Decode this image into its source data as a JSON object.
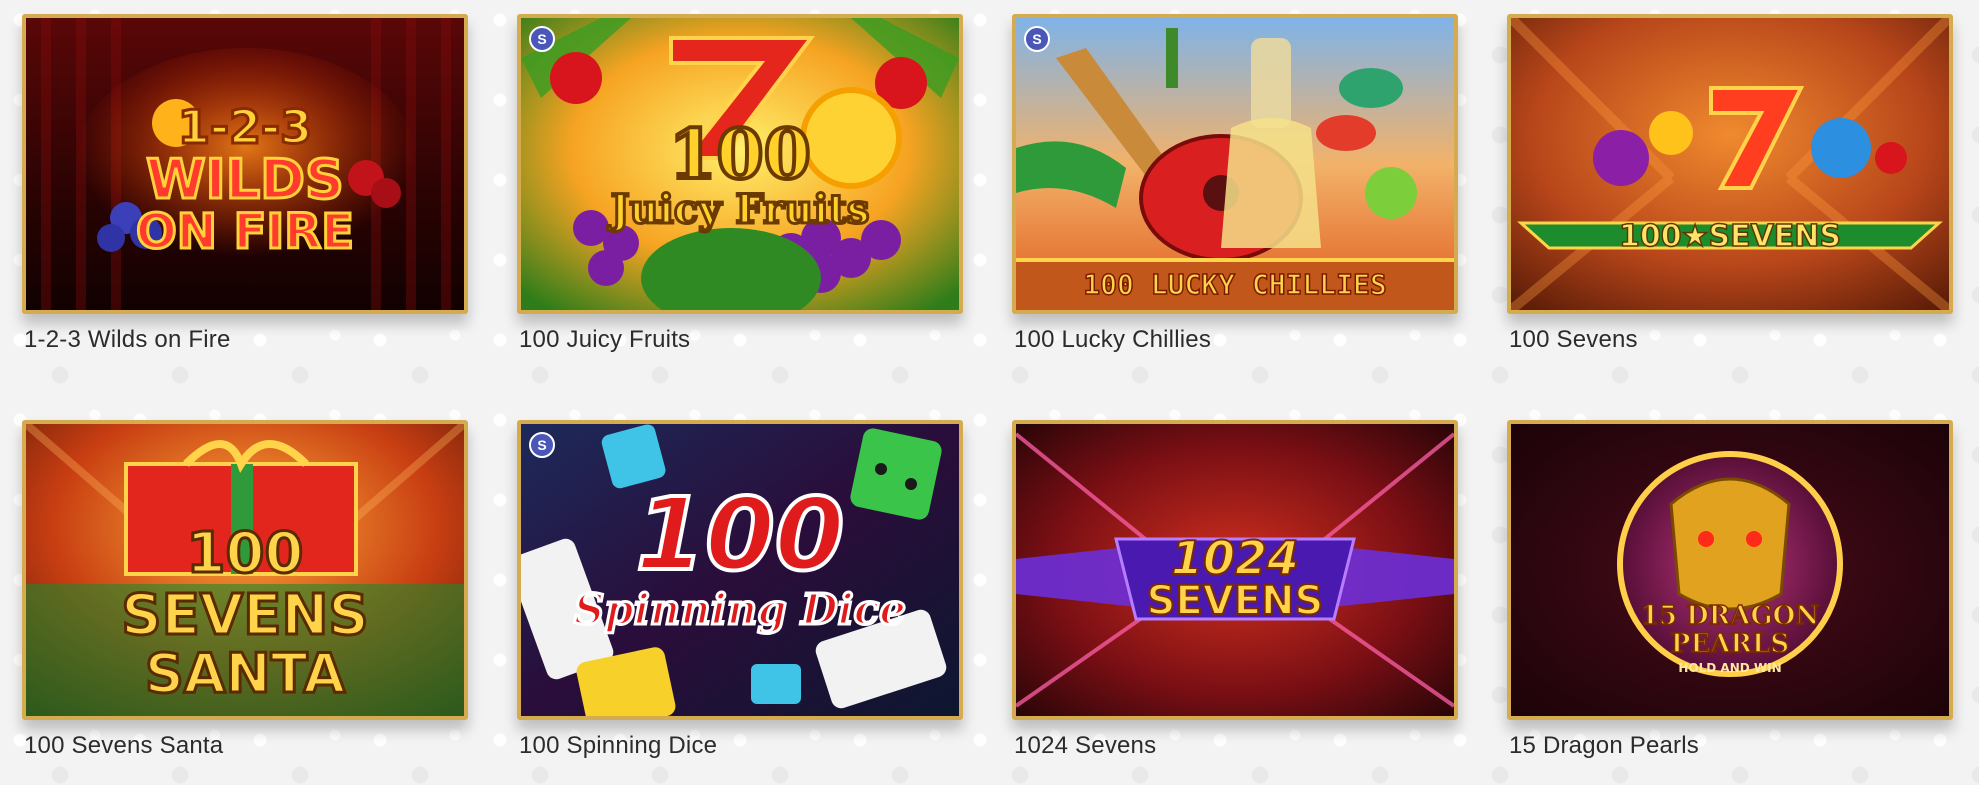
{
  "games": [
    {
      "title": "1-2-3 Wilds on Fire",
      "logo_lines": [
        "1-2-3",
        "WILDS",
        "ON FIRE"
      ],
      "badge": ""
    },
    {
      "title": "100 Juicy Fruits",
      "logo_lines": [
        "100",
        "Juicy Fruits"
      ],
      "badge": "S"
    },
    {
      "title": "100 Lucky Chillies",
      "logo_lines": [
        "100 LUCKY CHILLIES"
      ],
      "badge": "S"
    },
    {
      "title": "100 Sevens",
      "logo_lines": [
        "100★SEVENS"
      ],
      "badge": ""
    },
    {
      "title": "100 Sevens Santa",
      "logo_lines": [
        "100",
        "SEVENS",
        "SANTA"
      ],
      "badge": ""
    },
    {
      "title": "100 Spinning Dice",
      "logo_lines": [
        "100",
        "Spinning Dice"
      ],
      "badge": "S"
    },
    {
      "title": "1024 Sevens",
      "logo_lines": [
        "1024",
        "SEVENS"
      ],
      "badge": ""
    },
    {
      "title": "15 Dragon Pearls",
      "logo_lines": [
        "15 DRAGON",
        "PEARLS",
        "HOLD AND WIN"
      ],
      "badge": ""
    }
  ],
  "colors": {
    "frame": "#d4ab4e",
    "title_text": "#2c2c2c",
    "page_bg": "#f3f3f3"
  }
}
